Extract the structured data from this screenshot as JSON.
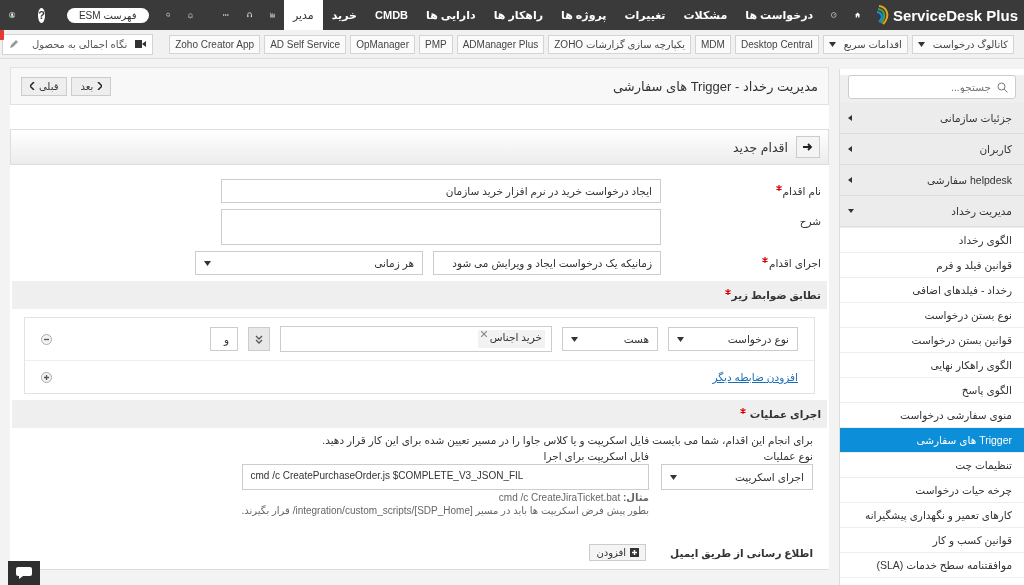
{
  "nav": {
    "logo": "ServiceDesk Plus",
    "tabs": [
      {
        "label": "درخواست ها",
        "selected": false
      },
      {
        "label": "مشکلات",
        "selected": false
      },
      {
        "label": "تغییرات",
        "selected": false
      },
      {
        "label": "پروژه ها",
        "selected": false
      },
      {
        "label": "راهکار ها",
        "selected": false
      },
      {
        "label": "دارایی ها",
        "selected": false
      },
      {
        "label": "CMDB",
        "selected": false
      },
      {
        "label": "خرید",
        "selected": false
      },
      {
        "label": "مدیر",
        "selected": true
      }
    ],
    "esm_button": "فهرست ESM",
    "help": "?"
  },
  "toolbar": {
    "dropdowns": [
      "کاتالوگ درخواست",
      "اقدامات سریع"
    ],
    "links": [
      "Desktop Central",
      "MDM",
      "یکپارچه سازی گزارشات ZOHO",
      "ADManager Plus",
      "PMP",
      "OpManager",
      "AD Self Service",
      "Zoho Creator App"
    ],
    "glance_placeholder": "نگاه اجمالی به محصول"
  },
  "sidebar": {
    "search_placeholder": "جستجو...",
    "groups": [
      {
        "label": "جزئیات سازمانی",
        "expanded": false
      },
      {
        "label": "کاربران",
        "expanded": false
      },
      {
        "label": "helpdesk سفارشی",
        "expanded": false
      },
      {
        "label": "مدیریت رخداد",
        "expanded": true
      }
    ],
    "items": [
      {
        "label": "الگوی رخداد",
        "selected": false
      },
      {
        "label": "قوانین فیلد و فرم",
        "selected": false
      },
      {
        "label": "رخداد - فیلدهای اضافی",
        "selected": false
      },
      {
        "label": "نوع بستن درخواست",
        "selected": false
      },
      {
        "label": "قوانین بستن درخواست",
        "selected": false
      },
      {
        "label": "الگوی راهکار نهایی",
        "selected": false
      },
      {
        "label": "الگوی پاسخ",
        "selected": false
      },
      {
        "label": "منوی سفارشی درخواست",
        "selected": false
      },
      {
        "label": "Trigger های سفارشی",
        "selected": true
      },
      {
        "label": "تنظیمات چت",
        "selected": false
      },
      {
        "label": "چرخه حیات درخواست",
        "selected": false
      },
      {
        "label": "کارهای تعمیر و نگهداری پیشگیرانه",
        "selected": false
      },
      {
        "label": "قوانین کسب و کار",
        "selected": false
      },
      {
        "label": "موافقتنامه سطح خدمات (SLA)",
        "selected": false
      }
    ]
  },
  "page": {
    "title": "مدیریت رخداد - Trigger های سفارشی",
    "prev": "قبلی",
    "next": "بعد"
  },
  "form": {
    "section_title": "اقدام جدید",
    "name": {
      "label": "نام اقدام",
      "required": true,
      "value": "ایجاد درخواست خرید در نرم افزار خرید سازمان"
    },
    "description": {
      "label": "شرح"
    },
    "execute": {
      "label": "اجرای اقدام",
      "required": true,
      "options": [
        "زمانیکه یک درخواست ایجاد و ویرایش می شود",
        "هر زمانی"
      ]
    }
  },
  "criteria": {
    "title": "تطابق ضوابط زیر",
    "required": true,
    "rows": [
      {
        "field": "نوع درخواست",
        "operator": "هست",
        "values": [
          "خرید اجناس"
        ],
        "join": "و"
      }
    ],
    "add_link": "افزودن ضابطه دیگر"
  },
  "actions": {
    "title": "اجرای عملیات",
    "required": true,
    "note": "برای انجام این اقدام، شما می بایست فایل اسکریپت و یا کلاس جاوا را در مسیر تعیین شده برای این کار قرار دهید.",
    "type_label": "نوع عملیات",
    "type_value": "اجرای اسکریپت",
    "script_label": "فایل اسکریپت برای اجرا",
    "script_value": "cmd /c CreatePurchaseOrder.js $COMPLETE_V3_JSON_FIL",
    "example": "**مثال:** cmd /c CreateJiraTicket.bat",
    "path_note": "بطور پیش فرض اسکریپت ها باید در مسیر [SDP_Home]/integration/custom_scripts/ قرار بگیرند."
  },
  "email": {
    "title": "اطلاع رسانی از طریق ایمیل",
    "add_button": "افزودن"
  }
}
